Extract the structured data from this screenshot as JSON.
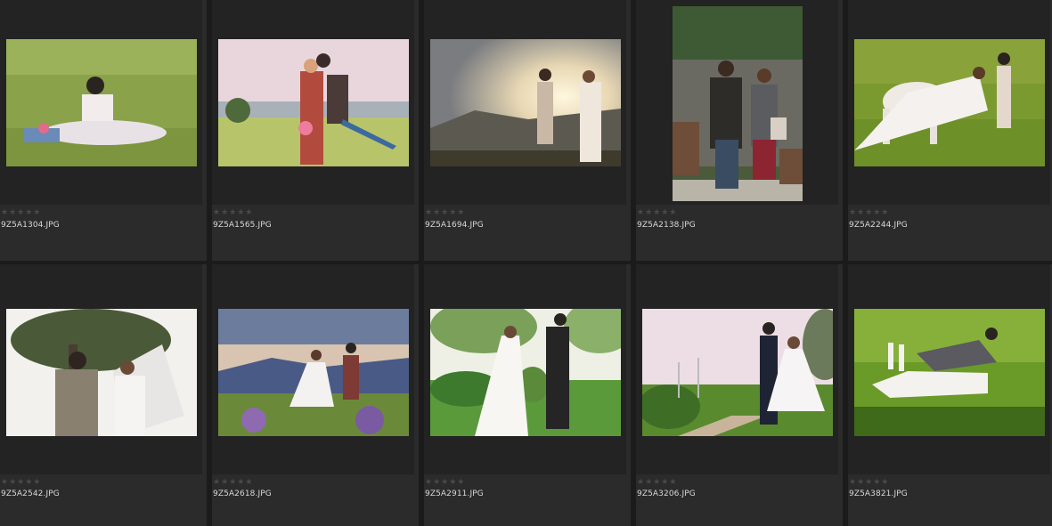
{
  "colors": {
    "cell_bg": "#2b2b2b",
    "image_area_bg": "#232323",
    "star_empty": "#4a4a4a",
    "filename_text": "#d8d8d8"
  },
  "rating_glyph": "★★★★★",
  "photos": [
    {
      "filename": "9Z5A1304.JPG",
      "icon": "photo-couple-lying-grass",
      "rating": 0
    },
    {
      "filename": "9Z5A1565.JPG",
      "icon": "photo-couple-guitar-jump",
      "rating": 0
    },
    {
      "filename": "9Z5A1694.JPG",
      "icon": "photo-couple-sunset-field",
      "rating": 0
    },
    {
      "filename": "9Z5A2138.JPG",
      "icon": "photo-couple-standing-garden",
      "rating": 0
    },
    {
      "filename": "9Z5A2244.JPG",
      "icon": "photo-bride-white-horse",
      "rating": 0
    },
    {
      "filename": "9Z5A2542.JPG",
      "icon": "photo-couple-under-tree",
      "rating": 0
    },
    {
      "filename": "9Z5A2618.JPG",
      "icon": "photo-couple-lakeside",
      "rating": 0
    },
    {
      "filename": "9Z5A2911.JPG",
      "icon": "photo-couple-garden-holding-hands",
      "rating": 0
    },
    {
      "filename": "9Z5A3206.JPG",
      "icon": "photo-couple-kissing-path",
      "rating": 0
    },
    {
      "filename": "9Z5A3821.JPG",
      "icon": "photo-couple-lying-lawn",
      "rating": 0
    }
  ]
}
